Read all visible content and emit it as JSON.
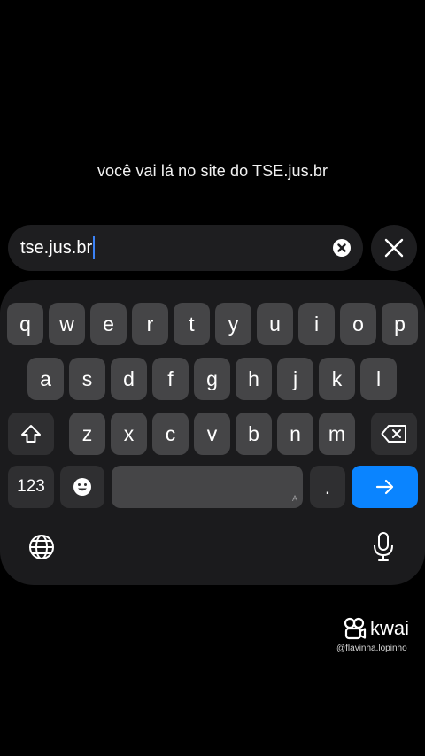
{
  "caption": "você vai lá no site do TSE.jus.br",
  "search": {
    "value": "tse.jus.br",
    "clear_icon": "clear-circle-x-icon",
    "close_icon": "close-x-icon"
  },
  "keyboard": {
    "row1": [
      "q",
      "w",
      "e",
      "r",
      "t",
      "y",
      "u",
      "i",
      "o",
      "p"
    ],
    "row2": [
      "a",
      "s",
      "d",
      "f",
      "g",
      "h",
      "j",
      "k",
      "l"
    ],
    "row3": [
      "z",
      "x",
      "c",
      "v",
      "b",
      "n",
      "m"
    ],
    "numbers_label": "123",
    "period_label": ".",
    "space_hint": "A",
    "enter_icon": "arrow-right-icon",
    "shift_icon": "shift-icon",
    "backspace_icon": "backspace-icon",
    "emoji_icon": "emoji-icon",
    "globe_icon": "globe-icon",
    "mic_icon": "microphone-icon"
  },
  "watermark": {
    "brand": "kwai",
    "handle": "@flavinha.lopinho"
  },
  "colors": {
    "background": "#000000",
    "keyboard_bg": "#1b1b1d",
    "key_bg": "#454547",
    "key_dark_bg": "#2f2f31",
    "enter_bg": "#0a84ff",
    "cursor": "#3b82f6"
  }
}
